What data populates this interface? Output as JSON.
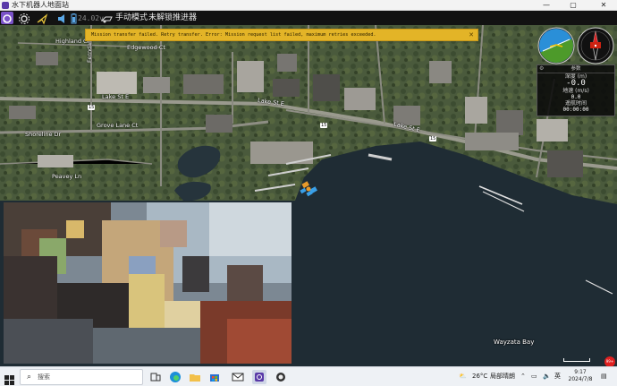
{
  "window": {
    "title": "水下机器人地面站",
    "minimize": "—",
    "maximize": "▢",
    "close": "✕"
  },
  "toolbar": {
    "battery_voltage": "24.02v",
    "mode": "手动模式",
    "thruster_status": "未解锁推进器"
  },
  "error_banner": {
    "message": "Mission transfer failed. Retry transfer. Error: Mission request list failed, maximum retries exceeded.",
    "close": "✕"
  },
  "telemetry": {
    "header": "参数",
    "depth_label": "深度 (m)",
    "depth_value": "-0.0",
    "speed_label": "地速 (m/s)",
    "speed_value": "0.0",
    "time_label": "遥航时间",
    "time_value": "00:00:00"
  },
  "map": {
    "labels": {
      "highland": "Highland Cir",
      "ferndale": "Ferndale",
      "edgewood": "Edgewood Ct",
      "lake_st_e_1": "Lake St E",
      "lake_st_e_2": "Lake St E",
      "lake_st_e_3": "Lake St E",
      "route15_a": "15",
      "route15_b": "15",
      "route15_c": "15",
      "shoreline": "Shoreline Dr",
      "grove_lane": "Grove Lane Ct",
      "peavey": "Peavey Ln",
      "bay": "Wayzata Bay"
    },
    "colors": {
      "water": "#1f2c34",
      "land": "#5e6c4e",
      "road": "#9a9a8e"
    }
  },
  "taskbar": {
    "search_placeholder": "搜索",
    "weather_temp": "26°C",
    "weather_desc": "局部晴朗",
    "ime": "英",
    "time": "9:17",
    "date": "2024/7/8"
  },
  "badge": {
    "text": "99+"
  }
}
